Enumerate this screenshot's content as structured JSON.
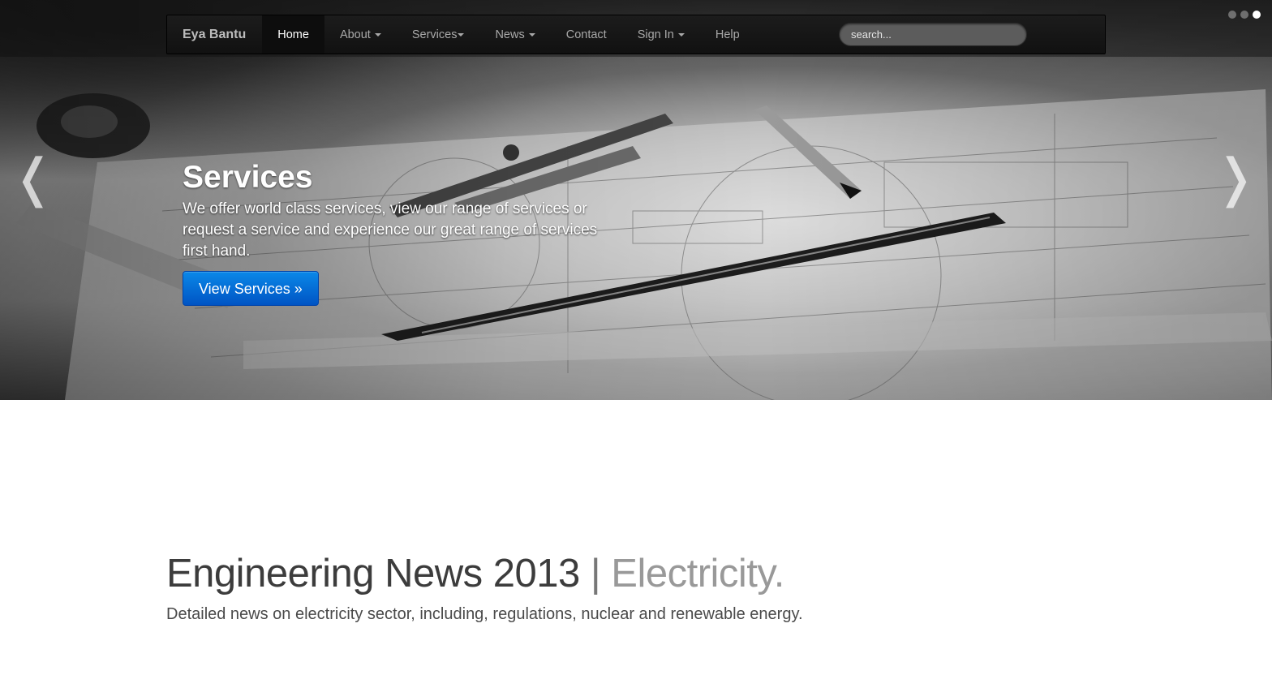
{
  "navbar": {
    "brand": "Eya Bantu",
    "items": [
      {
        "label": "Home",
        "active": true,
        "dropdown": false
      },
      {
        "label": "About",
        "dropdown": true
      },
      {
        "label": "Services",
        "dropdown": true
      },
      {
        "label": "News",
        "dropdown": true
      },
      {
        "label": "Contact",
        "dropdown": false
      },
      {
        "label": "Sign In",
        "dropdown": true
      },
      {
        "label": "Help",
        "dropdown": false
      }
    ],
    "search_placeholder": "search..."
  },
  "carousel": {
    "slide_count": 3,
    "active_slide": 3,
    "prev_glyph": "❬",
    "next_glyph": "❭",
    "caption": {
      "title": "Services",
      "text": "We offer world class services, view our range of services or request a service and experience our great range of services first hand.",
      "button_label": "View Services »"
    }
  },
  "section": {
    "heading_main": "Engineering News 2013",
    "heading_sep": "|",
    "heading_muted": "Electricity.",
    "lead": "Detailed news on electricity sector, including, regulations, nuclear and renewable energy."
  },
  "colors": {
    "primary_button": "#0054c4",
    "navbar_bg": "#1c1c1c",
    "heading": "#3c3c3c",
    "heading_muted": "#999999"
  },
  "icons": [
    "chevron-left-icon",
    "chevron-right-icon",
    "caret-down-icon"
  ]
}
